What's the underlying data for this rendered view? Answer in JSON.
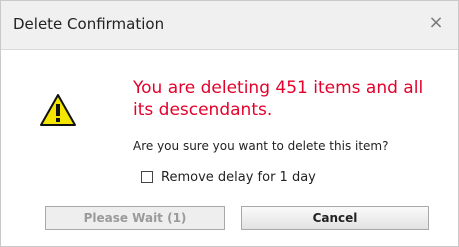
{
  "dialog": {
    "title": "Delete Confirmation",
    "close_symbol": "×"
  },
  "content": {
    "icon": "warning-icon",
    "message": "You are deleting 451 items and all its descendants.",
    "question": "Are you sure you want to delete this item?",
    "checkbox_label": "Remove delay for 1 day",
    "checkbox_checked": false
  },
  "buttons": {
    "wait_label": "Please Wait (1)",
    "cancel_label": "Cancel"
  },
  "colors": {
    "message_red": "#e4002b",
    "warning_yellow": "#f5e600",
    "titlebar_bg": "#f0f0f0"
  }
}
